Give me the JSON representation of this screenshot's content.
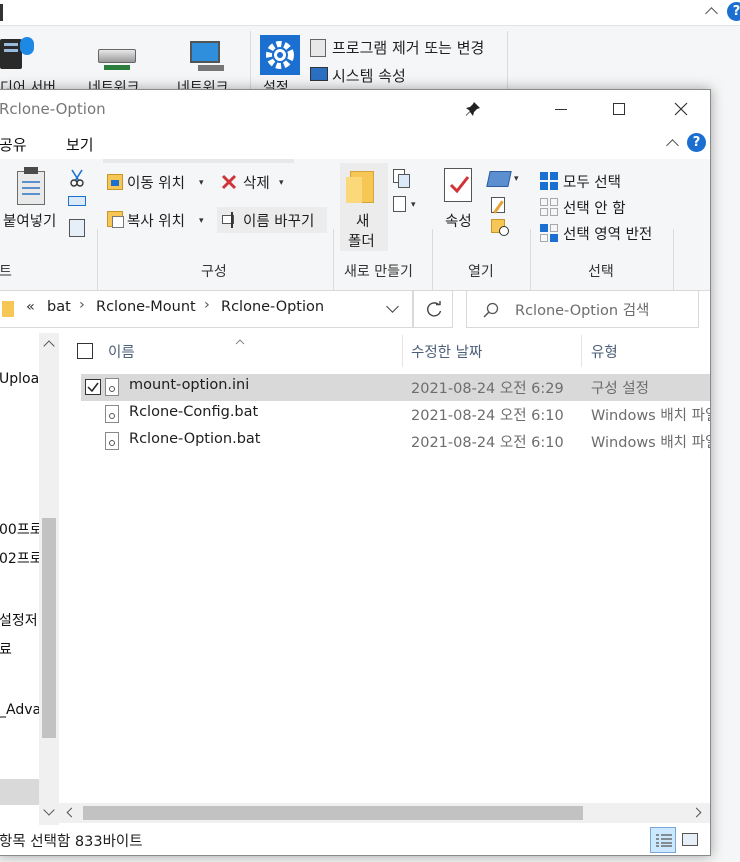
{
  "background_window": {
    "ribbon_items": [
      {
        "label": "디어 서버"
      },
      {
        "label": "네트워크"
      },
      {
        "label": "네트워크"
      },
      {
        "label": "설정"
      }
    ],
    "uninstall_label": "프로그램 제거 또는 변경",
    "system_props_label": "시스템 속성",
    "help_glyph": "?"
  },
  "window": {
    "title": "Rclone-Option",
    "help_glyph": "?"
  },
  "menu": [
    "공유",
    "보기"
  ],
  "ribbon": {
    "clipboard": {
      "paste_label": "붙여넣기",
      "group_label": "트"
    },
    "organize": {
      "move_to": "이동 위치",
      "delete": "삭제",
      "copy_to": "복사 위치",
      "rename": "이름 바꾸기",
      "group_label": "구성"
    },
    "new": {
      "new_folder_line1": "새",
      "new_folder_line2": "폴더",
      "group_label": "새로 만들기"
    },
    "open": {
      "properties": "속성",
      "group_label": "열기"
    },
    "select": {
      "select_all": "모두 선택",
      "select_none": "선택 안 함",
      "invert": "선택 영역 반전",
      "group_label": "선택"
    }
  },
  "address": {
    "overflow": "«",
    "crumbs": [
      "bat",
      "Rclone-Mount",
      "Rclone-Option"
    ],
    "search_placeholder": "Rclone-Option 검색"
  },
  "nav_items": [
    "Uploa",
    "00프로",
    "02프로",
    "설정저",
    "료",
    "_Adva"
  ],
  "columns": {
    "name": "이름",
    "modified": "수정한 날짜",
    "type": "유형"
  },
  "files": [
    {
      "name": "mount-option.ini",
      "modified": "2021-08-24 오전 6:29",
      "type": "구성 설정",
      "selected": true
    },
    {
      "name": "Rclone-Config.bat",
      "modified": "2021-08-24 오전 6:10",
      "type": "Windows 배치 파일",
      "selected": false
    },
    {
      "name": "Rclone-Option.bat",
      "modified": "2021-08-24 오전 6:10",
      "type": "Windows 배치 파일",
      "selected": false
    }
  ],
  "status": {
    "text": "항목 선택함 833바이트"
  },
  "colors": {
    "accent": "#1a6fd1",
    "selection": "#cce8ff",
    "selected_row": "#d9d9d9",
    "header_text": "#4c607a"
  }
}
